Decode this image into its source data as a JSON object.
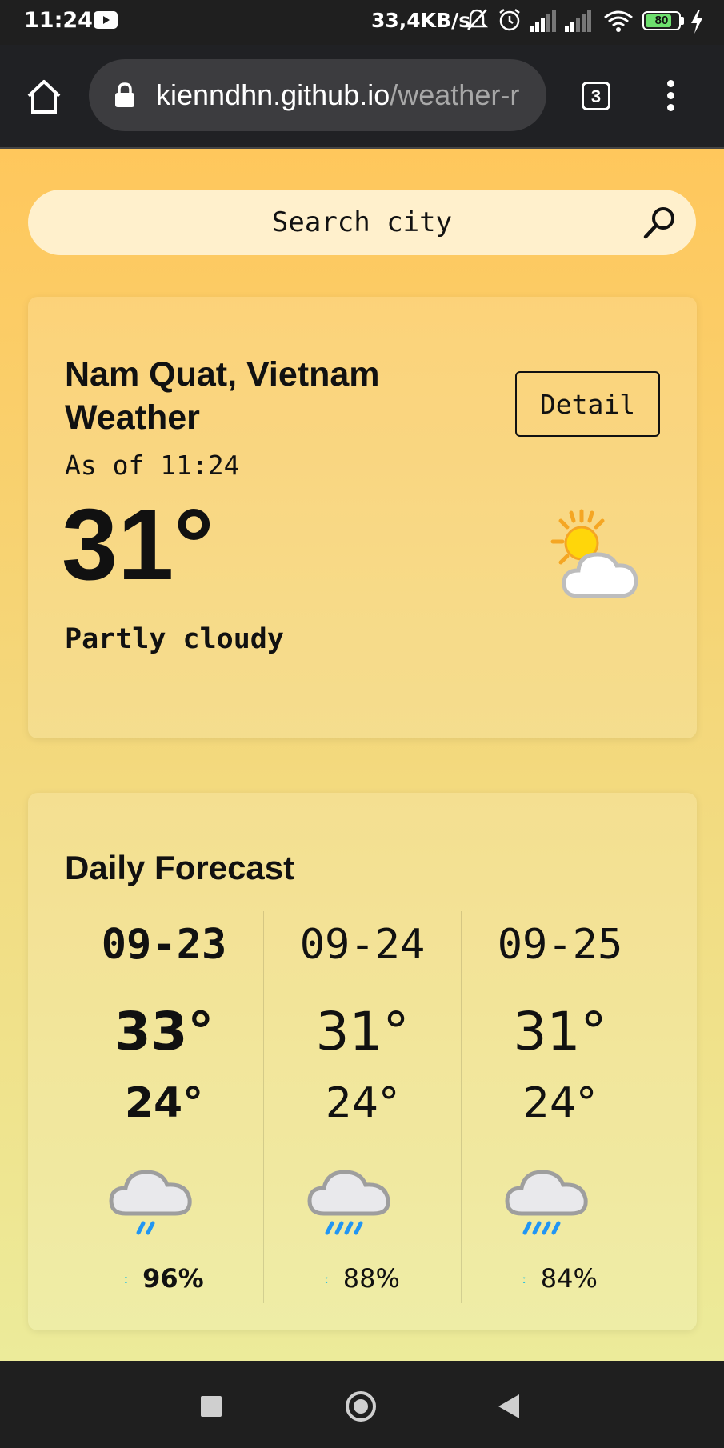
{
  "status_bar": {
    "time": "11:24",
    "net_speed": "33,4KB/s",
    "battery": "80",
    "battery_level": 0.8,
    "icons": [
      "youtube-icon",
      "mute-icon",
      "alarm-icon",
      "signal-icon",
      "signal-icon",
      "wifi-icon",
      "battery-icon",
      "charging-icon"
    ]
  },
  "browser": {
    "url_host": "kienndhn.github.io",
    "url_path": "/weather-r",
    "tab_count": "3",
    "icons": [
      "home-icon",
      "lock-icon",
      "menu-icon"
    ]
  },
  "search": {
    "placeholder": "Search city",
    "icon": "search-icon"
  },
  "current": {
    "title": "Nam Quat, Vietnam Weather",
    "detail_label": "Detail",
    "as_of": "As of 11:24",
    "temperature": "31°",
    "condition": "Partly cloudy",
    "icon": "partly-cloudy-icon"
  },
  "forecast": {
    "title": "Daily Forecast",
    "days": [
      {
        "date": "09-23",
        "high": "33°",
        "low": "24°",
        "pop": "96%",
        "icon": "light-rain-icon"
      },
      {
        "date": "09-24",
        "high": "31°",
        "low": "24°",
        "pop": "88%",
        "icon": "rain-icon"
      },
      {
        "date": "09-25",
        "high": "31°",
        "low": "24°",
        "pop": "84%",
        "icon": "rain-icon"
      }
    ]
  },
  "colors": {
    "page_top": "#ffc75c",
    "page_bottom": "#eceb9a",
    "search_bg": "#fff0cc",
    "rain_accent": "#27c0e0"
  }
}
